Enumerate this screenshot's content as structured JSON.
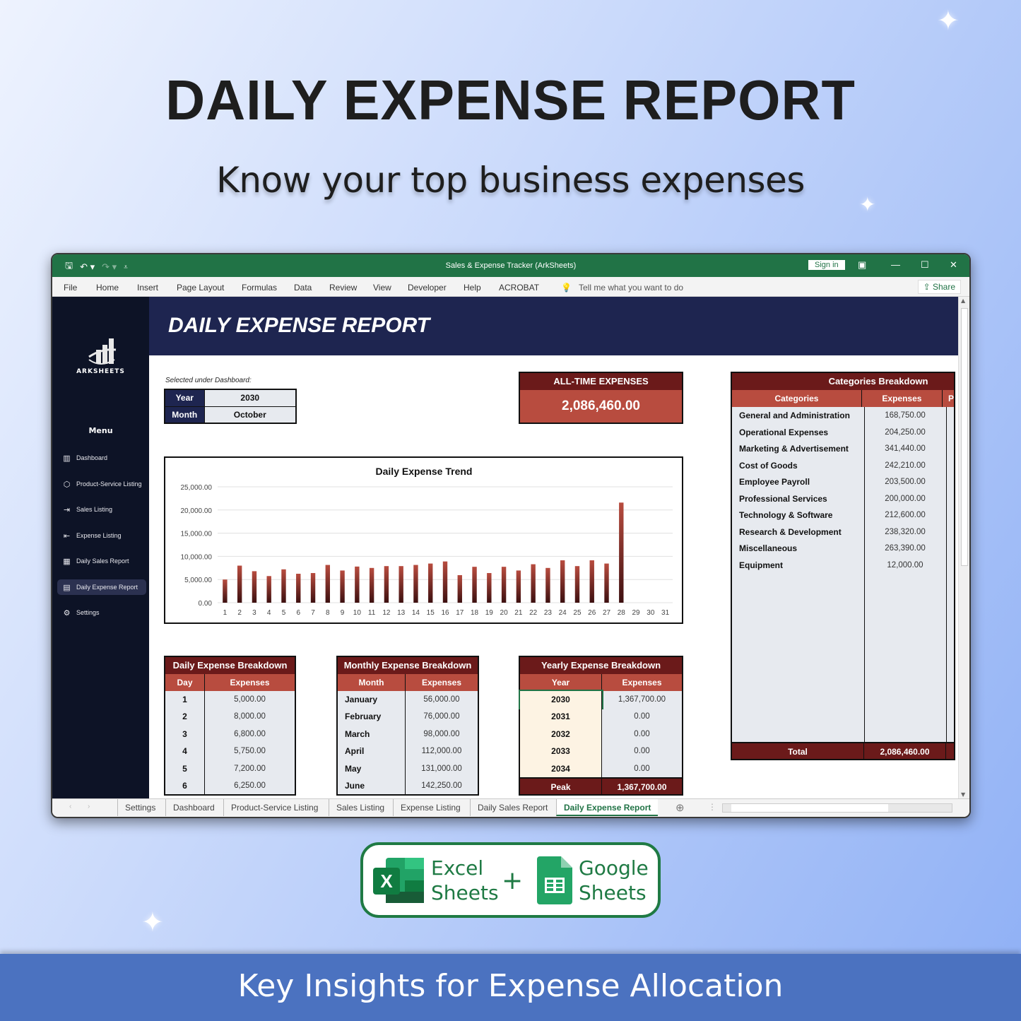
{
  "hero": {
    "title": "DAILY EXPENSE REPORT",
    "subtitle": "Know your top business expenses"
  },
  "window": {
    "title": "Sales & Expense Tracker (ArkSheets)",
    "sign_in": "Sign in",
    "quick_access": {
      "save": "save-icon",
      "undo": "undo-icon",
      "redo": "redo-icon",
      "customize": "customize-icon"
    },
    "ribbon_tabs": [
      "File",
      "Home",
      "Insert",
      "Page Layout",
      "Formulas",
      "Data",
      "Review",
      "View",
      "Developer",
      "Help",
      "ACROBAT"
    ],
    "tell_me": "Tell me what you want to do",
    "share": "Share"
  },
  "sidebar": {
    "brand": "ARKSHEETS",
    "menu_label": "Menu",
    "items": [
      {
        "label": "Dashboard",
        "icon": "chart-icon",
        "active": false
      },
      {
        "label": "Product-Service Listing",
        "icon": "box-icon",
        "active": false
      },
      {
        "label": "Sales Listing",
        "icon": "sales-icon",
        "active": false
      },
      {
        "label": "Expense Listing",
        "icon": "expense-icon",
        "active": false
      },
      {
        "label": "Daily Sales Report",
        "icon": "report-icon",
        "active": false
      },
      {
        "label": "Daily Expense Report",
        "icon": "report-icon",
        "active": true
      },
      {
        "label": "Settings",
        "icon": "gear-icon",
        "active": false
      }
    ]
  },
  "report": {
    "banner_title": "DAILY EXPENSE REPORT",
    "selection_caption": "Selected under Dashboard:",
    "year_label": "Year",
    "year_value": "2030",
    "month_label": "Month",
    "month_value": "October",
    "alltime_label": "ALL-TIME EXPENSES",
    "alltime_value": "2,086,460.00"
  },
  "chart_data": {
    "type": "bar",
    "title": "Daily Expense Trend",
    "xlabel": "",
    "ylabel": "",
    "ylim": [
      0,
      25000
    ],
    "yticks": [
      "0.00",
      "5,000.00",
      "10,000.00",
      "15,000.00",
      "20,000.00",
      "25,000.00"
    ],
    "categories": [
      "1",
      "2",
      "3",
      "4",
      "5",
      "6",
      "7",
      "8",
      "9",
      "10",
      "11",
      "12",
      "13",
      "14",
      "15",
      "16",
      "17",
      "18",
      "19",
      "20",
      "21",
      "22",
      "23",
      "24",
      "25",
      "26",
      "27",
      "28",
      "29",
      "30",
      "31"
    ],
    "values": [
      5000,
      8000,
      6800,
      5750,
      7200,
      6250,
      6400,
      8150,
      6950,
      7800,
      7500,
      7900,
      7900,
      8150,
      8450,
      8900,
      5950,
      7750,
      6400,
      7750,
      6950,
      8300,
      7500,
      9150,
      7900,
      9150,
      8450,
      21600,
      0,
      0,
      0
    ],
    "grid": true,
    "legend": "none",
    "bar_color": "#a8392e"
  },
  "daily_breakdown": {
    "title": "Daily Expense Breakdown",
    "headers": [
      "Day",
      "Expenses"
    ],
    "rows": [
      {
        "day": "1",
        "expenses": "5,000.00"
      },
      {
        "day": "2",
        "expenses": "8,000.00"
      },
      {
        "day": "3",
        "expenses": "6,800.00"
      },
      {
        "day": "4",
        "expenses": "5,750.00"
      },
      {
        "day": "5",
        "expenses": "7,200.00"
      },
      {
        "day": "6",
        "expenses": "6,250.00"
      }
    ]
  },
  "monthly_breakdown": {
    "title": "Monthly Expense Breakdown",
    "headers": [
      "Month",
      "Expenses"
    ],
    "rows": [
      {
        "month": "January",
        "expenses": "56,000.00"
      },
      {
        "month": "February",
        "expenses": "76,000.00"
      },
      {
        "month": "March",
        "expenses": "98,000.00"
      },
      {
        "month": "April",
        "expenses": "112,000.00"
      },
      {
        "month": "May",
        "expenses": "131,000.00"
      },
      {
        "month": "June",
        "expenses": "142,250.00"
      }
    ]
  },
  "yearly_breakdown": {
    "title": "Yearly Expense Breakdown",
    "headers": [
      "Year",
      "Expenses"
    ],
    "rows": [
      {
        "year": "2030",
        "expenses": "1,367,700.00"
      },
      {
        "year": "2031",
        "expenses": "0.00"
      },
      {
        "year": "2032",
        "expenses": "0.00"
      },
      {
        "year": "2033",
        "expenses": "0.00"
      },
      {
        "year": "2034",
        "expenses": "0.00"
      }
    ],
    "footer_label": "Peak",
    "footer_value": "1,367,700.00"
  },
  "categories_breakdown": {
    "title": "Categories Breakdown",
    "headers": [
      "Categories",
      "Expenses",
      "P"
    ],
    "rows": [
      {
        "category": "General and Administration",
        "expenses": "168,750.00"
      },
      {
        "category": "Operational Expenses",
        "expenses": "204,250.00"
      },
      {
        "category": "Marketing & Advertisement",
        "expenses": "341,440.00"
      },
      {
        "category": "Cost of Goods",
        "expenses": "242,210.00"
      },
      {
        "category": "Employee Payroll",
        "expenses": "203,500.00"
      },
      {
        "category": "Professional Services",
        "expenses": "200,000.00"
      },
      {
        "category": "Technology & Software",
        "expenses": "212,600.00"
      },
      {
        "category": "Research & Development",
        "expenses": "238,320.00"
      },
      {
        "category": "Miscellaneous",
        "expenses": "263,390.00"
      },
      {
        "category": "Equipment",
        "expenses": "12,000.00"
      }
    ],
    "footer_label": "Total",
    "footer_value": "2,086,460.00"
  },
  "sheet_tabs": {
    "tabs": [
      "Settings",
      "Dashboard",
      "Product-Service Listing",
      "Sales Listing",
      "Expense Listing",
      "Daily Sales Report",
      "Daily Expense Report"
    ],
    "active": "Daily Expense Report"
  },
  "badge": {
    "excel_line1": "Excel",
    "excel_line2": "Sheets",
    "plus": "+",
    "google_line1": "Google",
    "google_line2": "Sheets"
  },
  "footer": {
    "text": "Key Insights for Expense Allocation"
  },
  "colors": {
    "excel_green": "#217346",
    "navy": "#1e2550",
    "sidebar": "#0d1326",
    "maroon": "#6b1a1a",
    "brick": "#b84c3f",
    "footer_blue": "#4b72c0"
  }
}
